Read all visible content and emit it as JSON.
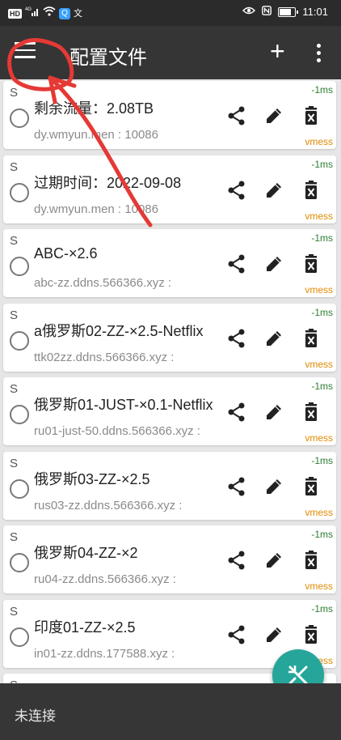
{
  "status_bar": {
    "left_icons": [
      "hd-icon",
      "signal-icon",
      "wifi-icon",
      "qq-icon",
      "translate-icon"
    ],
    "hd_text": "HD",
    "net_text": "4G",
    "translate_glyph": "文",
    "time": "11:01"
  },
  "app_bar": {
    "title": "配置文件",
    "add_glyph": "+"
  },
  "profiles": [
    {
      "s": "S",
      "name": "剩余流量：2.08TB",
      "address": "dy.wmyun.men : 10086",
      "latency": "-1ms",
      "type": "vmess"
    },
    {
      "s": "S",
      "name": "过期时间：2022-09-08",
      "address": "dy.wmyun.men : 10086",
      "latency": "-1ms",
      "type": "vmess"
    },
    {
      "s": "S",
      "name": "ABC-×2.6",
      "address": "abc-zz.ddns.566366.xyz :",
      "latency": "-1ms",
      "type": "vmess"
    },
    {
      "s": "S",
      "name": "a俄罗斯02-ZZ-×2.5-Netflix",
      "address": "ttk02zz.ddns.566366.xyz :",
      "latency": "-1ms",
      "type": "vmess"
    },
    {
      "s": "S",
      "name": "俄罗斯01-JUST-×0.1-Netflix",
      "address": "ru01-just-50.ddns.566366.xyz :",
      "latency": "-1ms",
      "type": "vmess"
    },
    {
      "s": "S",
      "name": "俄罗斯03-ZZ-×2.5",
      "address": "rus03-zz.ddns.566366.xyz :",
      "latency": "-1ms",
      "type": "vmess"
    },
    {
      "s": "S",
      "name": "俄罗斯04-ZZ-×2",
      "address": "ru04-zz.ddns.566366.xyz :",
      "latency": "-1ms",
      "type": "vmess"
    },
    {
      "s": "S",
      "name": "印度01-ZZ-×2.5",
      "address": "in01-zz.ddns.177588.xyz :",
      "latency": "-1ms",
      "type": "vmess"
    },
    {
      "s": "S",
      "name": "",
      "address": "",
      "latency": "",
      "type": "vmess"
    }
  ],
  "bottom_bar": {
    "status": "未连接"
  },
  "colors": {
    "appbar": "#353535",
    "fab": "#26a69a",
    "latency": "#2e7d32",
    "type": "#e08a00",
    "annotation": "#e53935"
  }
}
